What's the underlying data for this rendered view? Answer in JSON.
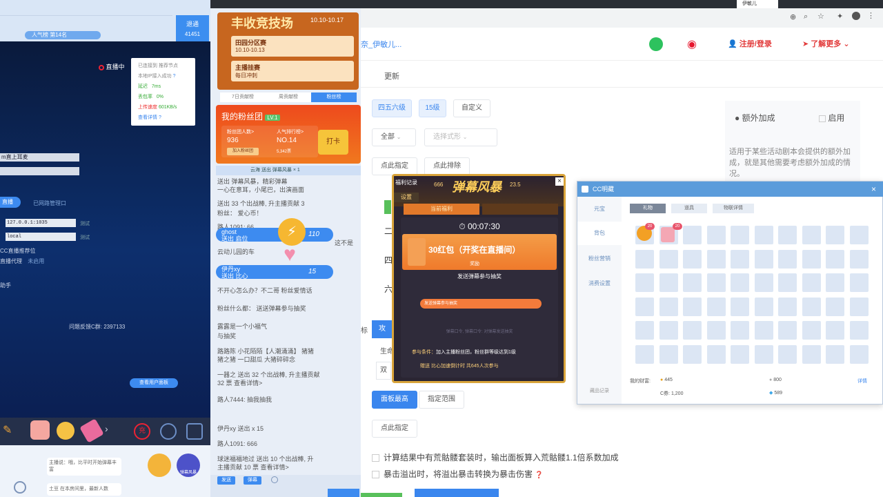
{
  "left": {
    "viewer_label": "41451",
    "follow_label": "退通",
    "rank_badge": "人气榜 第14名",
    "live_status": "直播中",
    "net_card": {
      "lines": [
        "已连接到 推荐节点",
        "本地IP接入成功"
      ],
      "latency_label": "延迟",
      "latency_value": "7ms",
      "loss_label": "丢包率",
      "loss_value": "0%",
      "upload_label": "上传速度",
      "upload_value": "601KB/s",
      "detail_label": "查看详情"
    },
    "rows": [
      "m直上耳麦",
      ""
    ],
    "proxy_tab": "直播",
    "proxy_tab2": "已网路管理口",
    "proxy_addr": "127.0.0.1:1035",
    "proxy_action": "测试",
    "proxy_local": "local",
    "proxy_local_action": "测试",
    "cc_live_label": "CC直播推荐位",
    "proxy_label": "直播代理",
    "proxy_off": "未启用",
    "misc": "助手",
    "feedback": "问题反馈C群: 2397133",
    "open_btn": "查看用户面板",
    "chat_hint": "主播说：哦，比平时开始弹幕丰富",
    "chat_line2": "土豆  在本房间里，最新人数",
    "gifts": [
      "broom",
      "pig",
      "face",
      "firework"
    ],
    "badge1": "弹幕风暴"
  },
  "mid": {
    "banner_title": "丰收竞技场",
    "banner_date": "10.10-10.17",
    "banner_card1_title": "田园分区赛",
    "banner_card1_date": "10.10-10.13",
    "banner_card2_title": "主播挂赛",
    "banner_card2_sub": "每日冲刺",
    "tabs": [
      "7日贡献榜",
      "周贡献榜",
      "粉丝榜"
    ],
    "fan": {
      "title": "我的粉丝团",
      "level": "LV.1",
      "members_label": "粉丝团人数>",
      "members_value": "936",
      "popular_label": "人气排行榜>",
      "popular_value": "NO.14",
      "join_btn": "加入粉丝团",
      "popular_sub": "5,342票",
      "checkin": "打卡"
    },
    "msgs": [
      {
        "name": "",
        "text": "云海  送出 弹幕风暴 × 1"
      },
      {
        "name": "",
        "text": "送出 弹幕风暴，精彩弹幕"
      },
      {
        "name": "",
        "text": "一心在意耳，小尾巴，出演画面"
      },
      {
        "name": "出",
        "text": "送出 33 个出战棒, 升主播贡献 3"
      },
      {
        "name": "",
        "text": "粉丝：  爱心币！"
      },
      {
        "name": "",
        "text": "路人1091: 66"
      },
      {
        "name": "",
        "text": "云动儿园的车"
      },
      {
        "name": "",
        "text": "不开心怎么办？不二哥  粉丝爱情话"
      },
      {
        "name": "",
        "text": "粉丝什么都：  送送弹幕参与抽奖"
      },
      {
        "name": "",
        "text": "露露是一个小福气"
      },
      {
        "name": "",
        "text": "与抽奖"
      },
      {
        "name": "",
        "text": "路路陈  小花陌陌【人潮涌涌】  猪猪"
      },
      {
        "name": "",
        "text": "猪之猪  一口甜瓜  大猪碎碎念"
      },
      {
        "name": "",
        "text": "一器之  送出 32 个出战棒, 升主播贡献"
      },
      {
        "name": "",
        "text": "32 票  查看详情>"
      },
      {
        "name": "",
        "text": "路人7444: 抽我抽我"
      },
      {
        "name": "",
        "text": "伊丹xy  送出  x 15"
      },
      {
        "name": "",
        "text": "路人1091: 666"
      },
      {
        "name": "",
        "text": "球迷福福地过  送出 10 个出战棒, 升"
      },
      {
        "name": "",
        "text": "主播贡献 10 票  查看详情>"
      }
    ],
    "pill1_name": "ghost",
    "pill1_sub": "送出 启位",
    "pill1_count": "110",
    "pill1_tail": "这不是",
    "pill2_name": "伊丹xy",
    "pill2_sub": "送出 比心",
    "pill2_count": "15",
    "input_btn": "发送",
    "input_btn2": "弹幕"
  },
  "right": {
    "browser": {
      "tab_label": "伊敏儿"
    },
    "header": {
      "brand": "奈_伊敏儿...",
      "login": "注册/登录",
      "more": "了解更多"
    },
    "subnav": "更新",
    "chips": [
      "四五六级",
      "15级",
      "自定义"
    ],
    "select1": "全部",
    "select2": "选择式形",
    "btns_row": [
      "点此指定",
      "点此排除"
    ],
    "extra": {
      "title": "额外加成",
      "enable": "启用",
      "desc": "适用于某些活动剧本会提供的额外加成，就是其他需要考虑额外加成的情况。"
    },
    "left_labels": [
      "二",
      "四",
      "六"
    ],
    "label_sheng": "生命",
    "label_gong": "攻",
    "label_biao": "标",
    "row_btns": [
      "面板最高",
      "指定范围"
    ],
    "point_btn": "点此指定",
    "check1": "计算结果中有荒骷髅套装时，输出面板算入荒骷髅1.1倍系数加成",
    "check2": "暴击溢出时，将溢出暴击转换为暴击伤害",
    "bottom_btn": ""
  },
  "popup": {
    "record": "福利记录",
    "count": "666",
    "title": "弹幕风暴",
    "title_sub": "23.5",
    "settings": "设置",
    "tab_active": "当前福利",
    "timer": "00:07:30",
    "prize": "30红包（开奖在直播间）",
    "prize_sub": "奖励",
    "action": "发送弹幕参与抽奖",
    "input_placeholder": "发送弹幕参与抽奖",
    "note": "弹幕口令, 弹幕口令: 对弹幕发送抽奖",
    "cond_label": "参与条件：",
    "cond_text": "加入主播粉丝团，粉丝群等级达到1级",
    "line2": "赠送 比心加速倒计时 共645人次参与"
  },
  "cc": {
    "title": "CC明藏",
    "side": [
      "元宝",
      "背包",
      "粉丝营销",
      "消费设置"
    ],
    "side_bottom": "藏品记录",
    "tabs": [
      "礼物",
      "道具",
      "物联详情"
    ],
    "assets_label": "我的财富:",
    "coin1": "445",
    "coin2": "800",
    "c_label": "C券: 1,200",
    "diamond": "589",
    "assets_link": "详情",
    "slot1_badge": "20",
    "slot2_badge": "20"
  }
}
